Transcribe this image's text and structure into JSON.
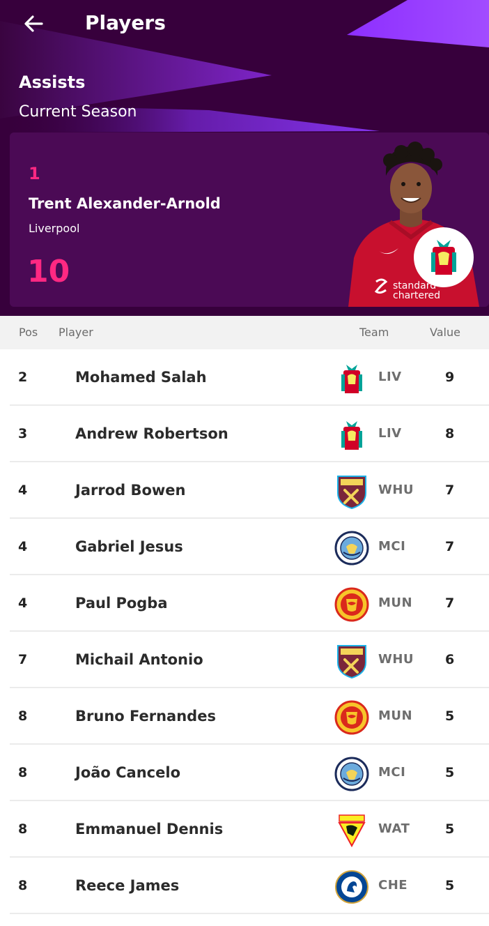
{
  "header": {
    "nav_title": "Players",
    "stat_title": "Assists",
    "season": "Current Season"
  },
  "leader": {
    "rank": "1",
    "name": "Trent Alexander-Arnold",
    "club": "Liverpool",
    "value": "10",
    "shirt_sponsor": "standard chartered",
    "badge_icon": "liverpool-crest-icon"
  },
  "table": {
    "columns": {
      "pos": "Pos",
      "player": "Player",
      "team": "Team",
      "value": "Value"
    },
    "rows": [
      {
        "pos": "2",
        "name": "Mohamed Salah",
        "team": "LIV",
        "value": "9",
        "badge": "liverpool-crest-icon"
      },
      {
        "pos": "3",
        "name": "Andrew Robertson",
        "team": "LIV",
        "value": "8",
        "badge": "liverpool-crest-icon"
      },
      {
        "pos": "4",
        "name": "Jarrod Bowen",
        "team": "WHU",
        "value": "7",
        "badge": "west-ham-crest-icon"
      },
      {
        "pos": "4",
        "name": "Gabriel Jesus",
        "team": "MCI",
        "value": "7",
        "badge": "man-city-crest-icon"
      },
      {
        "pos": "4",
        "name": "Paul Pogba",
        "team": "MUN",
        "value": "7",
        "badge": "man-united-crest-icon"
      },
      {
        "pos": "7",
        "name": "Michail Antonio",
        "team": "WHU",
        "value": "6",
        "badge": "west-ham-crest-icon"
      },
      {
        "pos": "8",
        "name": "Bruno Fernandes",
        "team": "MUN",
        "value": "5",
        "badge": "man-united-crest-icon"
      },
      {
        "pos": "8",
        "name": "João Cancelo",
        "team": "MCI",
        "value": "5",
        "badge": "man-city-crest-icon"
      },
      {
        "pos": "8",
        "name": "Emmanuel Dennis",
        "team": "WAT",
        "value": "5",
        "badge": "watford-crest-icon"
      },
      {
        "pos": "8",
        "name": "Reece James",
        "team": "CHE",
        "value": "5",
        "badge": "chelsea-crest-icon"
      }
    ]
  },
  "colors": {
    "header_bg": "#37003c",
    "card_bg": "#4b0a55",
    "accent_pink": "#ff2882",
    "accent_purple": "#963cff"
  }
}
